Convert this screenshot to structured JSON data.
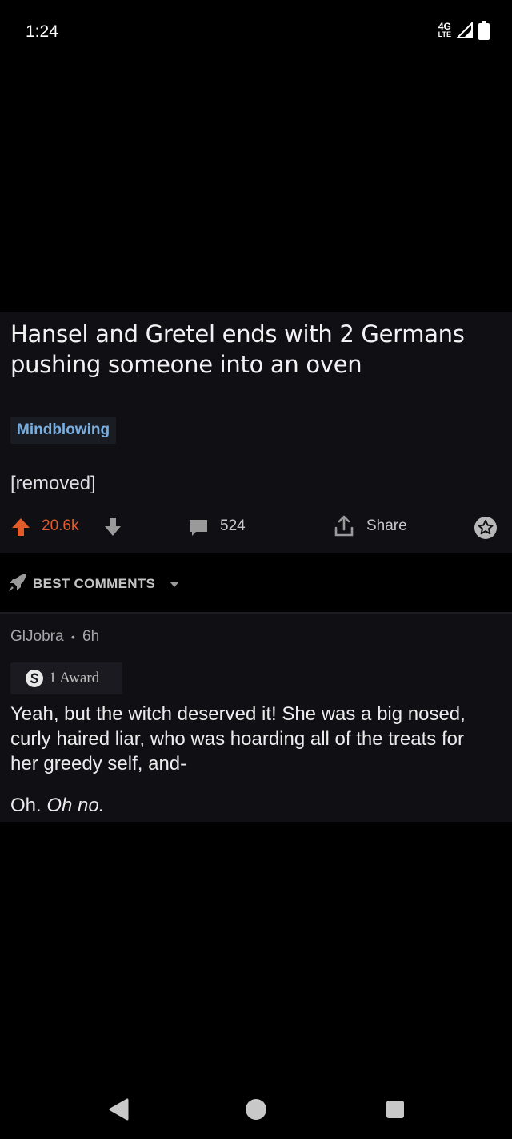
{
  "status_bar": {
    "time": "1:24",
    "network_label_top": "4G",
    "network_label_bottom": "LTE"
  },
  "post": {
    "title": "Hansel and Gretel ends with 2 Germans pushing someone into an oven",
    "flair": "Mindblowing",
    "body": "[removed]",
    "score": "20.6k",
    "comment_count": "524",
    "share_label": "Share",
    "colors": {
      "upvote": "#e35a2b",
      "flair_text": "#79aee0"
    }
  },
  "comments_sort": {
    "label": "BEST COMMENTS"
  },
  "comment": {
    "author": "GlJobra",
    "separator": "•",
    "age": "6h",
    "award_label": "1 Award",
    "body": "Yeah, but the witch deserved it! She was a big nosed, curly haired liar, who was hoarding all of the treats for her greedy self, and-",
    "tail_normal": "Oh.",
    "tail_italic": "Oh no."
  },
  "icons": {
    "battery": "battery-icon",
    "signal": "signal-icon",
    "upvote": "upvote-arrow-icon",
    "downvote": "downvote-arrow-icon",
    "comment": "comment-bubble-icon",
    "share": "share-icon",
    "star": "star-icon",
    "sort": "rocket-icon",
    "award": "silver-award-icon",
    "back": "back-triangle-icon",
    "home": "home-circle-icon",
    "recents": "recents-square-icon"
  }
}
